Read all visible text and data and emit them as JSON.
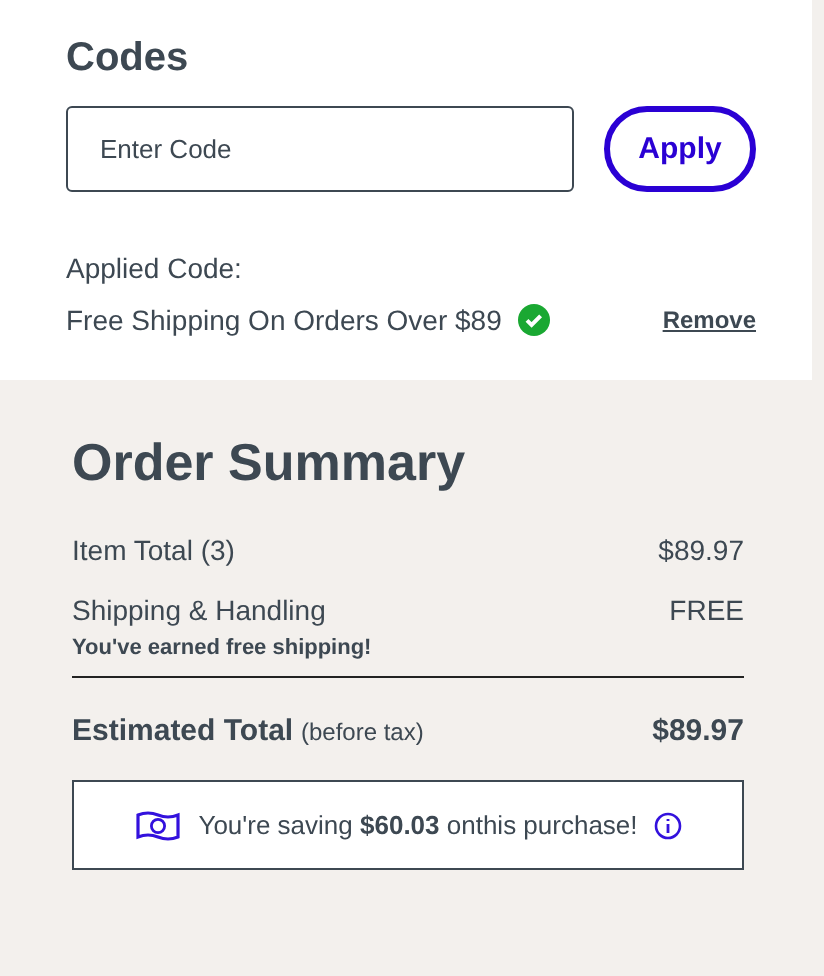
{
  "codes": {
    "title": "Codes",
    "input": {
      "placeholder": "Enter Code"
    },
    "apply_button": "Apply",
    "applied_label": "Applied Code:",
    "applied_code": {
      "text": "Free Shipping On Orders Over $89",
      "valid": true,
      "remove": "Remove"
    }
  },
  "order_summary": {
    "title": "Order Summary",
    "rows": [
      {
        "label": "Item Total (3)",
        "value": "$89.97"
      },
      {
        "label": "Shipping & Handling",
        "value": "FREE",
        "note": "You've earned free shipping!"
      }
    ],
    "total": {
      "label": "Estimated Total",
      "qualifier": "(before tax)",
      "value": "$89.97"
    },
    "savings": {
      "text": "You're saving **$60.03** onthis purchase!"
    }
  }
}
